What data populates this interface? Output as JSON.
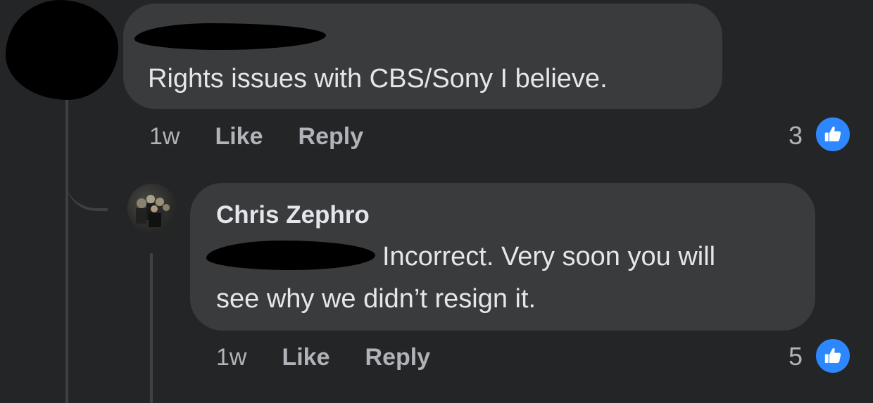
{
  "comment1": {
    "text": "Rights issues with CBS/Sony I believe.",
    "time": "1w",
    "like_label": "Like",
    "reply_label": "Reply",
    "reaction_count": "3"
  },
  "comment2": {
    "author": "Chris Zephro",
    "text_line1": "Incorrect. Very soon you will",
    "text_line2": "see why we didn’t resign it.",
    "time": "1w",
    "like_label": "Like",
    "reply_label": "Reply",
    "reaction_count": "5"
  },
  "colors": {
    "background": "#242526",
    "bubble": "#3a3b3c",
    "like_blue": "#2d88ff",
    "text": "#e4e6eb",
    "meta": "#b0b3b8"
  },
  "icons": {
    "reaction": "thumbs-up-icon"
  }
}
